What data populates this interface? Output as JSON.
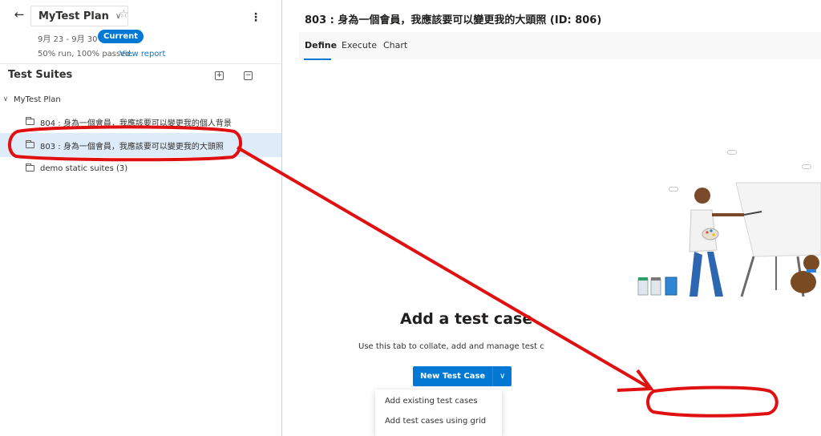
{
  "plan": {
    "back_icon": "arrow-left-icon",
    "name": "MyTest Plan",
    "date_range": "9月 23 - 9月 30",
    "current_badge": "Current",
    "run_status": "50% run, 100% passed.",
    "view_report": "View report"
  },
  "tree": {
    "title": "Test Suites",
    "root": "MyTest Plan",
    "items": [
      {
        "label": "804 : 身為一個會員，我應該要可以變更我的個人背景",
        "selected": false
      },
      {
        "label": "803 : 身為一個會員，我應該要可以變更我的大頭照",
        "selected": true
      },
      {
        "label": "demo static suites (3)",
        "selected": false
      }
    ]
  },
  "main": {
    "title": "803 : 身為一個會員，我應該要可以變更我的大頭照 (ID: 806)",
    "tabs": [
      {
        "label": "Define",
        "active": true
      },
      {
        "label": "Execute",
        "active": false
      },
      {
        "label": "Chart",
        "active": false
      }
    ],
    "empty_state": {
      "title": "Add a test case",
      "description": "Use this tab to collate, add and manage test c",
      "new_button": "New Test Case",
      "menu": [
        "Add existing test cases",
        "Add test cases using grid"
      ]
    }
  },
  "colors": {
    "accent": "#0078d4",
    "selected_row": "#deecf9",
    "annotation": "#e01010"
  }
}
